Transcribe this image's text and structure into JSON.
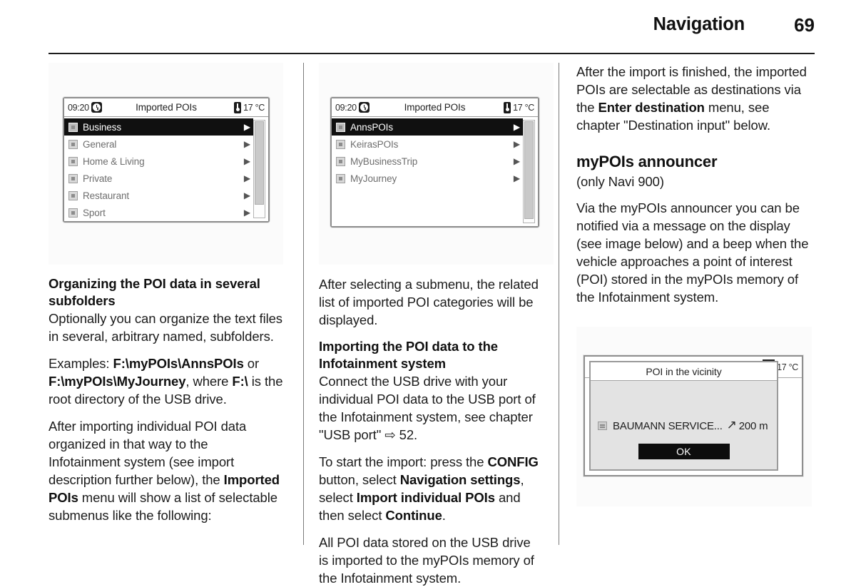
{
  "header": {
    "chapter": "Navigation",
    "page_number": "69"
  },
  "figures": {
    "imported_pois_categories": {
      "status_bar": {
        "time": "09:20",
        "clock_icon": "clock-icon",
        "title": "Imported POIs",
        "thermometer_icon": "thermometer-icon",
        "temperature": "17 °C"
      },
      "rows": [
        {
          "label": "Business",
          "selected": true
        },
        {
          "label": "General",
          "selected": false
        },
        {
          "label": "Home & Living",
          "selected": false
        },
        {
          "label": "Private",
          "selected": false
        },
        {
          "label": "Restaurant",
          "selected": false
        },
        {
          "label": "Sport",
          "selected": false
        }
      ],
      "row_arrow_glyph": "▶"
    },
    "imported_pois_submenus": {
      "status_bar": {
        "time": "09:20",
        "clock_icon": "clock-icon",
        "title": "Imported POIs",
        "thermometer_icon": "thermometer-icon",
        "temperature": "17 °C"
      },
      "rows": [
        {
          "label": "AnnsPOIs",
          "selected": true
        },
        {
          "label": "KeirasPOIs",
          "selected": false
        },
        {
          "label": "MyBusinessTrip",
          "selected": false
        },
        {
          "label": "MyJourney",
          "selected": false
        }
      ],
      "row_arrow_glyph": "▶"
    },
    "poi_announcer_popup": {
      "status_bar": {
        "compass_icon": "compass-icon",
        "temperature": "17 °C"
      },
      "popup_title": "POI in the vicinity",
      "poi_icon": "poi-list-icon",
      "poi_name": "BAUMANN SERVICE...",
      "direction_arrow": "↗",
      "distance": "200 m",
      "ok_label": "OK"
    }
  },
  "column1": {
    "heading": "Organizing the POI data in several subfolders",
    "p1": "Optionally you can organize the text files in several, arbitrary named, subfolders.",
    "p2_pre": "Examples: ",
    "p2_b1": "F:\\myPOIs\\AnnsPOIs",
    "p2_mid": " or ",
    "p2_b2": "F:\\myPOIs\\MyJourney",
    "p2_mid2": ", where ",
    "p2_b3": "F:\\",
    "p2_post": " is the root directory of the USB drive.",
    "p3_pre": "After importing individual POI data organized in that way to the Infotainment system (see import description further below), the ",
    "p3_b1": "Imported POIs",
    "p3_post": " menu will show a list of selectable submenus like the following:"
  },
  "column2": {
    "p1": "After selecting a submenu, the related list of imported POI categories will be displayed.",
    "heading": "Importing the POI data to the Infotainment system",
    "p2_pre": "Connect the USB drive with your individual POI data to the USB port of the Infotainment system, see chapter \"USB port\" ",
    "p2_ref_glyph": "⇨",
    "p2_ref_page": " 52.",
    "p3_pre": "To start the import: press the ",
    "p3_b1": "CONFIG",
    "p3_m1": " button, select ",
    "p3_b2": "Navigation settings",
    "p3_m2": ", select ",
    "p3_b3": "Import individual POIs",
    "p3_m3": " and then select ",
    "p3_b4": "Continue",
    "p3_post": ".",
    "p4": "All POI data stored on the USB drive is imported to the myPOIs memory of the Infotainment system."
  },
  "column3": {
    "p1_pre": "After the import is finished, the imported POIs are selectable as destinations via the ",
    "p1_b1": "Enter destination",
    "p1_post": " menu, see chapter \"Destination input\" below.",
    "heading": "myPOIs announcer",
    "subnote": "(only Navi 900)",
    "p2": "Via the myPOIs announcer you can be notified via a message on the display (see image below) and a beep when the vehicle approaches a point of interest (POI) stored in the myPOIs memory of the Infotainment system."
  }
}
